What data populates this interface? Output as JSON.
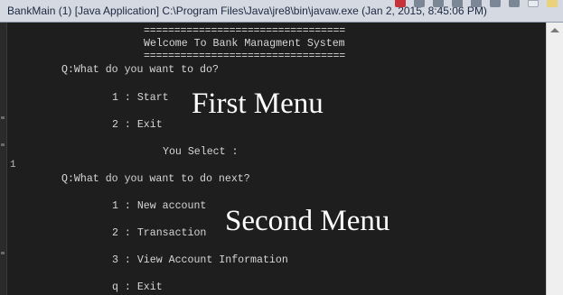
{
  "window": {
    "title": "BankMain (1) [Java Application] C:\\Program Files\\Java\\jre8\\bin\\javaw.exe (Jan 2, 2015, 8:45:06 PM)"
  },
  "console": {
    "gutter_number": "1",
    "lines": [
      "=================================",
      "Welcome To Bank Managment System",
      "=================================",
      "Q:What do you want to do?",
      "1 : Start",
      "2 : Exit",
      "You Select :",
      "Q:What do you want to do next?",
      "1 : New account",
      "2 : Transaction",
      "3 : View Account Information",
      "q : Exit"
    ]
  },
  "annotations": {
    "first_menu": "First Menu",
    "second_menu": "Second Menu"
  },
  "icons": {
    "toolbar": [
      "terminate-icon",
      "remove-launch-icon",
      "remove-all-icon",
      "scroll-lock-icon",
      "word-wrap-icon",
      "pin-console-icon",
      "display-console-icon",
      "minimize-icon",
      "maximize-icon"
    ]
  },
  "colors": {
    "console_background": "#1e1e1e",
    "console_text": "#d6d6d6",
    "annotation_text": "#ffffff",
    "titlebar_background": "#d5dae2"
  }
}
